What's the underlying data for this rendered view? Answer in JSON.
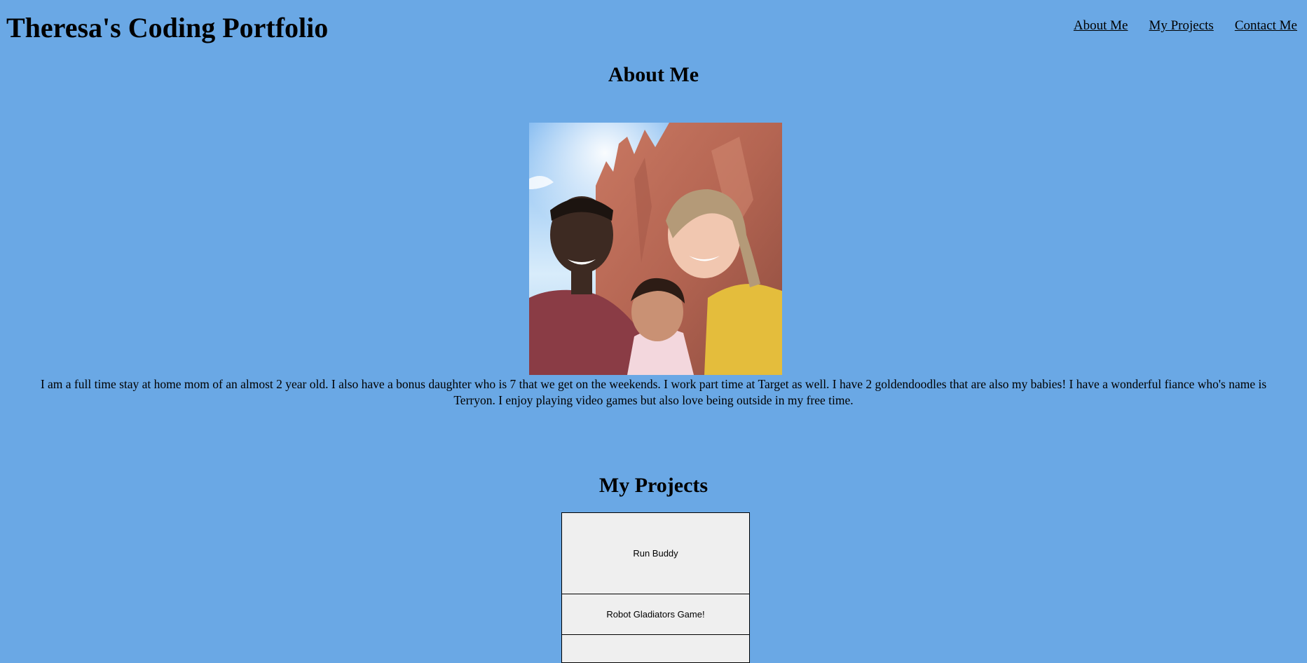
{
  "header": {
    "title": "Theresa's Coding Portfolio",
    "nav": [
      {
        "label": "About Me"
      },
      {
        "label": "My Projects"
      },
      {
        "label": "Contact Me"
      }
    ]
  },
  "about": {
    "heading": "About Me",
    "photo_description_icon": "family-photo",
    "text": "I am a full time stay at home mom of an almost 2 year old. I also have a bonus daughter who is 7 that we get on the weekends. I work part time at Target as well. I have 2 goldendoodles that are also my babies! I have a wonderful fiance who's name is Terryon. I enjoy playing video games but also love being outside in my free time."
  },
  "projects": {
    "heading": "My Projects",
    "items": [
      {
        "label": "Run Buddy"
      },
      {
        "label": "Robot Gladiators Game!"
      },
      {
        "label": ""
      }
    ]
  },
  "colors": {
    "background": "#6aa8e5",
    "card_background": "#efefef"
  }
}
